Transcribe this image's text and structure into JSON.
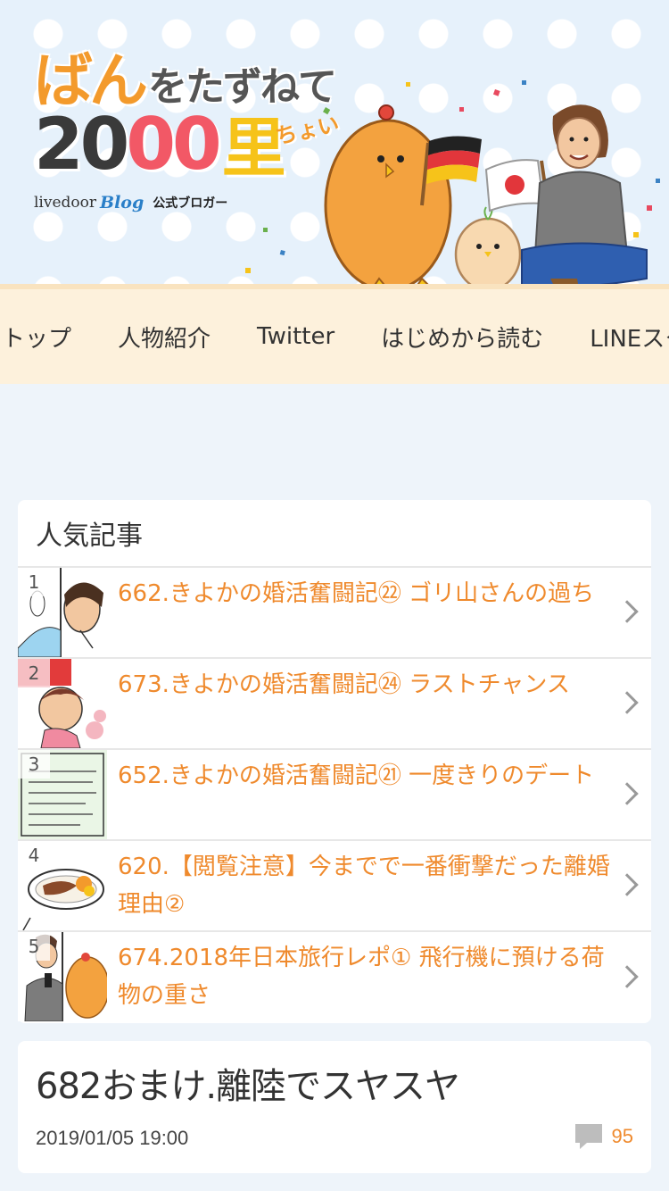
{
  "blog": {
    "logo_han": "ばん",
    "logo_rest": "をたずねて",
    "logo_20": "20",
    "logo_00": "00",
    "logo_ri": "里",
    "logo_choi": "ちょい",
    "livedoor": "livedoor",
    "blog_mark": "Blog",
    "official": "公式ブロガー"
  },
  "nav": {
    "items": [
      "トップ",
      "人物紹介",
      "Twitter",
      "はじめから読む",
      "LINEスタンプ"
    ]
  },
  "popular": {
    "title": "人気記事",
    "items": [
      {
        "rank": "1",
        "title": "662.きよかの婚活奮闘記㉒ ゴリ山さんの過ち"
      },
      {
        "rank": "2",
        "title": "673.きよかの婚活奮闘記㉔ ラストチャンス"
      },
      {
        "rank": "3",
        "title": "652.きよかの婚活奮闘記㉑ 一度きりのデート"
      },
      {
        "rank": "4",
        "title": "620.【閲覧注意】今までで一番衝撃だった離婚理由②"
      },
      {
        "rank": "5",
        "title": "674.2018年日本旅行レポ① 飛行機に預ける荷物の重さ"
      }
    ]
  },
  "article": {
    "title": "682おまけ.離陸でスヤスヤ",
    "date": "2019/01/05 19:00",
    "comment_count": "95"
  },
  "colors": {
    "accent": "#ef8a2d",
    "nav_bg": "#fdf1dc",
    "page_bg": "#eef4fa"
  }
}
